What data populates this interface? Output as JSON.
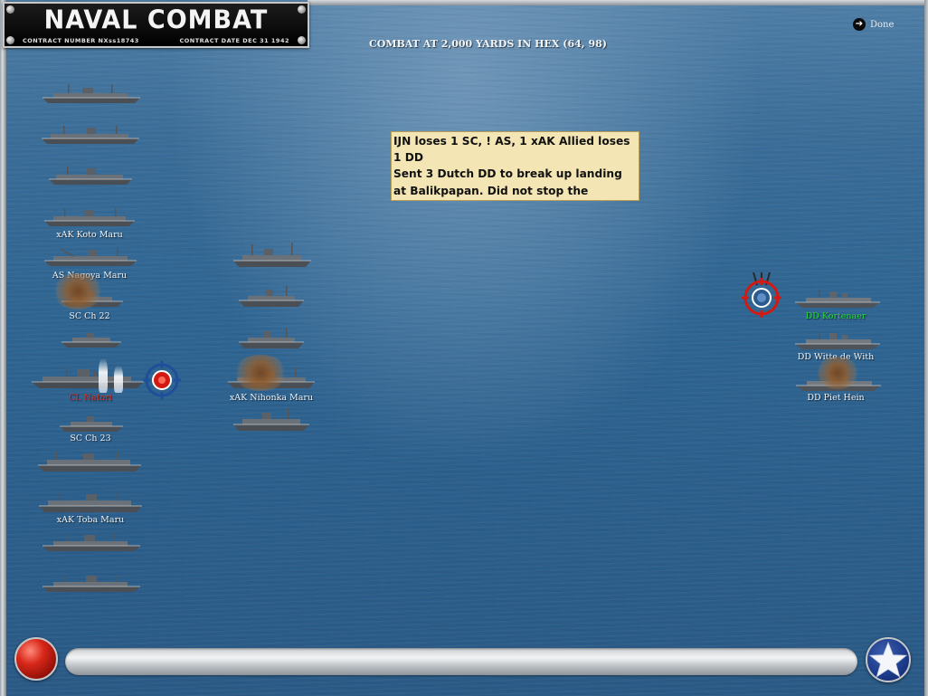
{
  "window": {
    "title": "NAVAL COMBAT",
    "contract_number": "CONTRACT NUMBER NXss18743",
    "contract_date": "CONTRACT DATE DEC 31 1942"
  },
  "header": {
    "combat_text": "COMBAT AT 2,000 YARDS IN HEX (64, 98)",
    "done_label": "Done",
    "done_icon": "arrow-right-icon"
  },
  "note": {
    "text": "IJN loses 1 SC, ! AS, 1 xAK  Allied loses 1 DD\nSent 3 Dutch DD to break up landing at Balikpapan. Did not stop the landing but it did delay it for one turn"
  },
  "japanese_column_1_labels": {
    "koto_maru": "xAK Koto Maru",
    "nagoya_maru": "AS Nagoya Maru",
    "sc_ch22": "SC Ch 22",
    "cl_name": "CL Natori",
    "sc_ch23": "SC Ch 23",
    "toba_maru": "xAK Toba Maru"
  },
  "japanese_column_2_labels": {
    "nihonkai_maru": "xAK Nihonka Maru"
  },
  "allied_labels": {
    "dd_kortenaer": "DD Kortenaer",
    "dd_witte_de_with": "DD Witte de With",
    "dd_piet_hein": "DD Piet Hein"
  },
  "colors": {
    "sea": "#2f6592",
    "note_bg": "#f3e6b4",
    "hit_red": "#e02a20",
    "hit_green": "#29d63a",
    "label": "#f0f3f5"
  },
  "controls": {
    "left_button_icon": "red-orb-icon",
    "right_button_icon": "white-star-icon"
  }
}
